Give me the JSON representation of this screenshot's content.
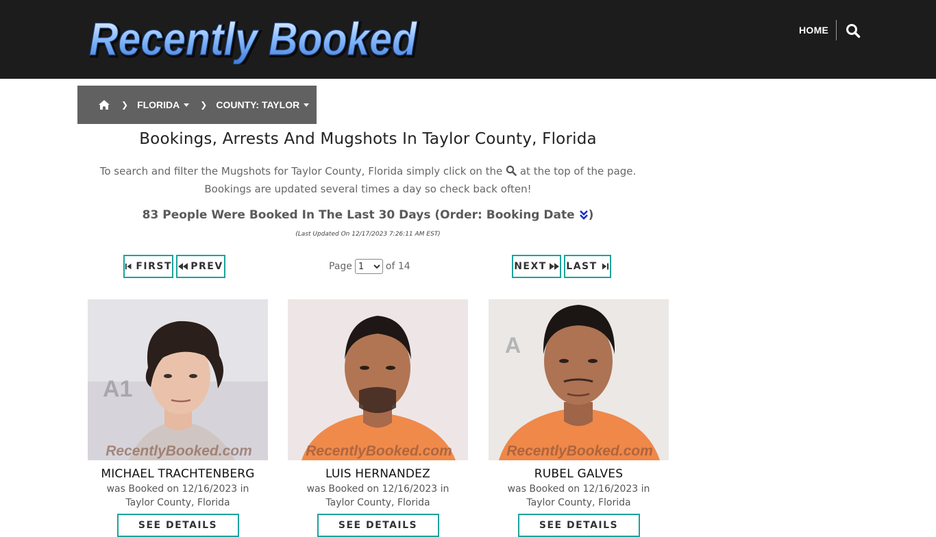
{
  "header": {
    "logo_text": "Recently Booked",
    "nav": {
      "home_label": "HOME",
      "search_icon": "search-icon"
    }
  },
  "breadcrumb": {
    "home_icon": "home-icon",
    "items": [
      {
        "label": "FLORIDA"
      },
      {
        "label": "COUNTY: TAYLOR"
      }
    ]
  },
  "main": {
    "title": "Bookings, Arrests And Mugshots In Taylor County, Florida",
    "intro_before": "To search and filter the Mugshots for Taylor County, Florida simply click on the",
    "intro_after": "at the top of the page. Bookings are updated several times a day so check back often!",
    "summary_text": "83 People Were Booked In The Last 30 Days (Order: Booking Date",
    "summary_close": ")",
    "last_updated": "(Last Updated On 12/17/2023 7:26:11 AM EST)"
  },
  "pager": {
    "first_label": "FIRST",
    "prev_label": "PREV",
    "next_label": "NEXT",
    "last_label": "LAST",
    "page_word": "Page",
    "current_page": "1",
    "of_text": "of 14"
  },
  "bookings": [
    {
      "name": "MICHAEL TRACHTENBERG",
      "line1": "was Booked on 12/16/2023 in",
      "line2": "Taylor County, Florida",
      "button_label": "SEE DETAILS",
      "watermark": "RecentlyBooked.com"
    },
    {
      "name": "LUIS HERNANDEZ",
      "line1": "was Booked on 12/16/2023 in",
      "line2": "Taylor County, Florida",
      "button_label": "SEE DETAILS",
      "watermark": "RecentlyBooked.com"
    },
    {
      "name": "RUBEL GALVES",
      "line1": "was Booked on 12/16/2023 in",
      "line2": "Taylor County, Florida",
      "button_label": "SEE DETAILS",
      "watermark": "RecentlyBooked.com"
    }
  ],
  "colors": {
    "header_bg": "#1c1c1c",
    "breadcrumb_bg": "#616161",
    "accent_teal": "#1ba39c",
    "logo_blue": "#6fa8f0"
  }
}
